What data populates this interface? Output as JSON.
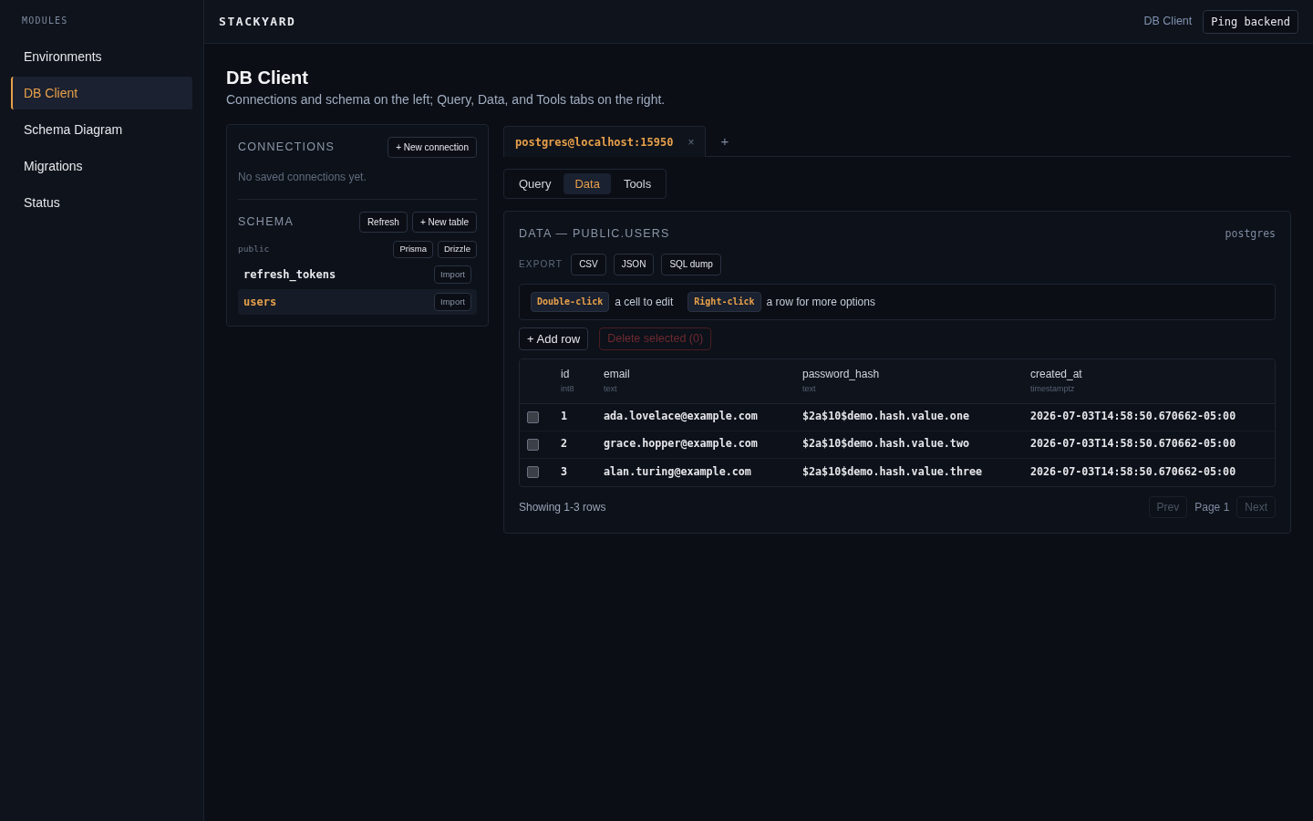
{
  "sidebar": {
    "heading": "MODULES",
    "items": [
      {
        "label": "Environments",
        "selected": false
      },
      {
        "label": "DB Client",
        "selected": true
      },
      {
        "label": "Schema Diagram",
        "selected": false
      },
      {
        "label": "Migrations",
        "selected": false
      },
      {
        "label": "Status",
        "selected": false
      }
    ]
  },
  "header": {
    "brand": "STACKYARD",
    "breadcrumb": "DB Client",
    "ping_button": "Ping backend"
  },
  "page": {
    "title": "DB Client",
    "subtitle": "Connections and schema on the left; Query, Data, and Tools tabs on the right."
  },
  "connections": {
    "heading": "CONNECTIONS",
    "new_button": "+ New connection",
    "empty_text": "No saved connections yet."
  },
  "schema": {
    "heading": "SCHEMA",
    "buttons": [
      "Refresh",
      "+ New table"
    ],
    "schema_name": "public",
    "generator_buttons": [
      "Prisma",
      "Drizzle"
    ],
    "tables": [
      {
        "name": "refresh_tokens",
        "action": "Import",
        "selected": false
      },
      {
        "name": "users",
        "action": "Import",
        "selected": true
      }
    ]
  },
  "connection_tabs": [
    {
      "label": "postgres@localhost:15950",
      "close": "×",
      "selected": true
    }
  ],
  "add_tab": "+",
  "view_tabs": [
    {
      "label": "Query",
      "selected": false
    },
    {
      "label": "Data",
      "selected": true
    },
    {
      "label": "Tools",
      "selected": false
    }
  ],
  "data_panel": {
    "title": "DATA — PUBLIC.USERS",
    "connection_user": "postgres",
    "export_label": "EXPORT",
    "export_buttons": [
      "CSV",
      "JSON",
      "SQL dump"
    ],
    "hints": [
      {
        "key": "Double-click",
        "text": "a cell to edit"
      },
      {
        "key": "Right-click",
        "text": "a row for more options"
      }
    ],
    "add_row_button": "+ Add row",
    "delete_button": {
      "label": "Delete selected (0)",
      "disabled": true
    },
    "table": {
      "columns": [
        {
          "name": "id",
          "type": "int8"
        },
        {
          "name": "email",
          "type": "text"
        },
        {
          "name": "password_hash",
          "type": "text"
        },
        {
          "name": "created_at",
          "type": "timestamptz"
        }
      ],
      "rows": [
        {
          "checked": false,
          "cells": [
            "1",
            "ada.lovelace@example.com",
            "$2a$10$demo.hash.value.one",
            "2026-07-03T14:58:50.670662-05:00"
          ]
        },
        {
          "checked": false,
          "cells": [
            "2",
            "grace.hopper@example.com",
            "$2a$10$demo.hash.value.two",
            "2026-07-03T14:58:50.670662-05:00"
          ]
        },
        {
          "checked": false,
          "cells": [
            "3",
            "alan.turing@example.com",
            "$2a$10$demo.hash.value.three",
            "2026-07-03T14:58:50.670662-05:00"
          ]
        }
      ]
    },
    "footer": {
      "summary": "Showing 1-3 rows",
      "prev": {
        "label": "Prev",
        "disabled": true
      },
      "page": "Page 1",
      "next": {
        "label": "Next",
        "disabled": true
      }
    }
  }
}
